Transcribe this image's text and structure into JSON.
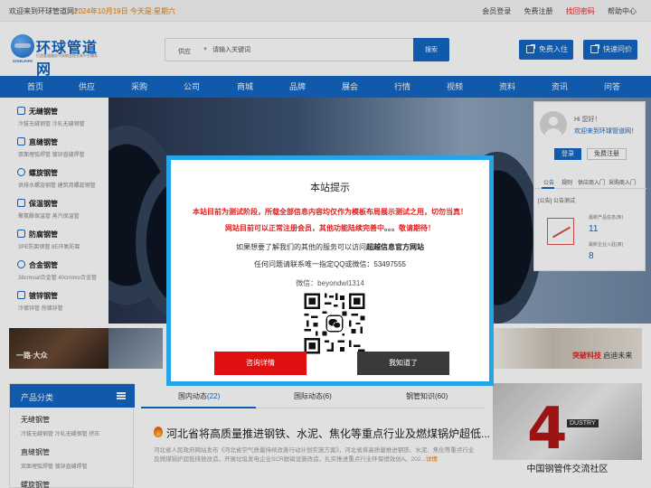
{
  "topbar": {
    "welcome": "欢迎来到环球管道网！",
    "date": "2024年10月19日  今天是:星期六",
    "links": [
      "会员登录",
      "免费注册",
      "找回密码",
      "帮助中心"
    ]
  },
  "header": {
    "logo_name": "环球管道网",
    "logo_sub": "打造管道服务与采购全程交易平台服务",
    "logo_en": "STEELPIPE",
    "search_category": "供应",
    "search_placeholder": "请输入关键词",
    "search_button": "搜索",
    "btn_join": "免费入住",
    "btn_ask": "快速问价"
  },
  "nav": [
    "首页",
    "供应",
    "采购",
    "公司",
    "商城",
    "品牌",
    "展会",
    "行情",
    "视频",
    "资料",
    "资讯",
    "问答"
  ],
  "categories": [
    {
      "name": "无缝钢管",
      "sub": "冷拔无缝钢管  冷轧无缝钢管"
    },
    {
      "name": "直缝钢管",
      "sub": "双面埋弧焊管  镀锌直缝焊管"
    },
    {
      "name": "螺旋钢管",
      "sub": "供排水螺旋钢管  建筑用螺旋钢管"
    },
    {
      "name": "保温钢管",
      "sub": "聚氨酯保温管  蒸汽保温管"
    },
    {
      "name": "防腐钢管",
      "sub": "3PE防腐钢管  8E环氧防腐"
    },
    {
      "name": "合金钢管",
      "sub": "38crmoal合金管  40crnimo合金管"
    },
    {
      "name": "镀锌钢管",
      "sub": "冷镀锌管  热镀锌管"
    }
  ],
  "login": {
    "hello": "Hi 您好！",
    "welcome": "欢迎来到环球管道网！",
    "login_btn": "登录",
    "register_btn": "免费注册",
    "tabs": [
      "公告",
      "规则",
      "供应商入门",
      "采购商入门"
    ],
    "notice": "[公告]  公告测试",
    "stat1_label": "最新产品信息(条)",
    "stat1_value": "11",
    "stat2_label": "最新企业入驻(家)",
    "stat2_value": "8"
  },
  "strips": {
    "left": "一路·大众",
    "right_brand": "突破科技",
    "right_text": "启迪未来"
  },
  "product_cat": {
    "title": "产品分类",
    "items": [
      {
        "name": "无缝钢管",
        "sub": "冷拔无缝钢管  冷轧无缝钢管  挤压"
      },
      {
        "name": "直缝钢管",
        "sub": "双面埋弧焊管  镀锌直缝焊管"
      },
      {
        "name": "螺旋钢管",
        "sub": ""
      }
    ]
  },
  "news": {
    "tabs": [
      {
        "label": "国内动态",
        "count": "(22)"
      },
      {
        "label": "国际动态",
        "count": "(6)"
      },
      {
        "label": "钢管知识",
        "count": "(60)"
      }
    ],
    "title": "河北省将高质量推进钢铁、水泥、焦化等重点行业及燃煤锅炉超低...",
    "body": "河北省人民政府网站发布《河北省空气质量持续改善行动计划实施方案》，河北省将高质量推进钢铁、水泥、焦化等重点行业及燃煤锅炉超低排放改造，开展垃圾发电企业SCR脱硝设施改造，扎实推进重点行业环保绩效创A。202...",
    "more": "详情"
  },
  "exchange": {
    "big": "4",
    "tag": "DUSTRY",
    "caption": "中国钢管件交流社区"
  },
  "modal": {
    "title": "本站提示",
    "line1": "本站目前为测试阶段，所载全部信息内容均仅作为模板布局展示测试之用，切勿当真！",
    "line2": "网站目前可以正常注册会员，其他功能陆续完善中。。。敬请期待！",
    "line3_pre": "如果想要了解我们的其他的服务可以访问",
    "line3_bold": "超越信息官方网站",
    "line4": "任何问题请联系唯一指定QQ或微信：53497555",
    "wechat": "微信：beyondwl1314",
    "btn_detail": "咨询详情",
    "btn_ok": "我知道了"
  },
  "colors": {
    "brand": "#1466c2",
    "modal_border": "#26a4e8",
    "warn_red": "#e02020",
    "accent_orange": "#e67e00"
  }
}
